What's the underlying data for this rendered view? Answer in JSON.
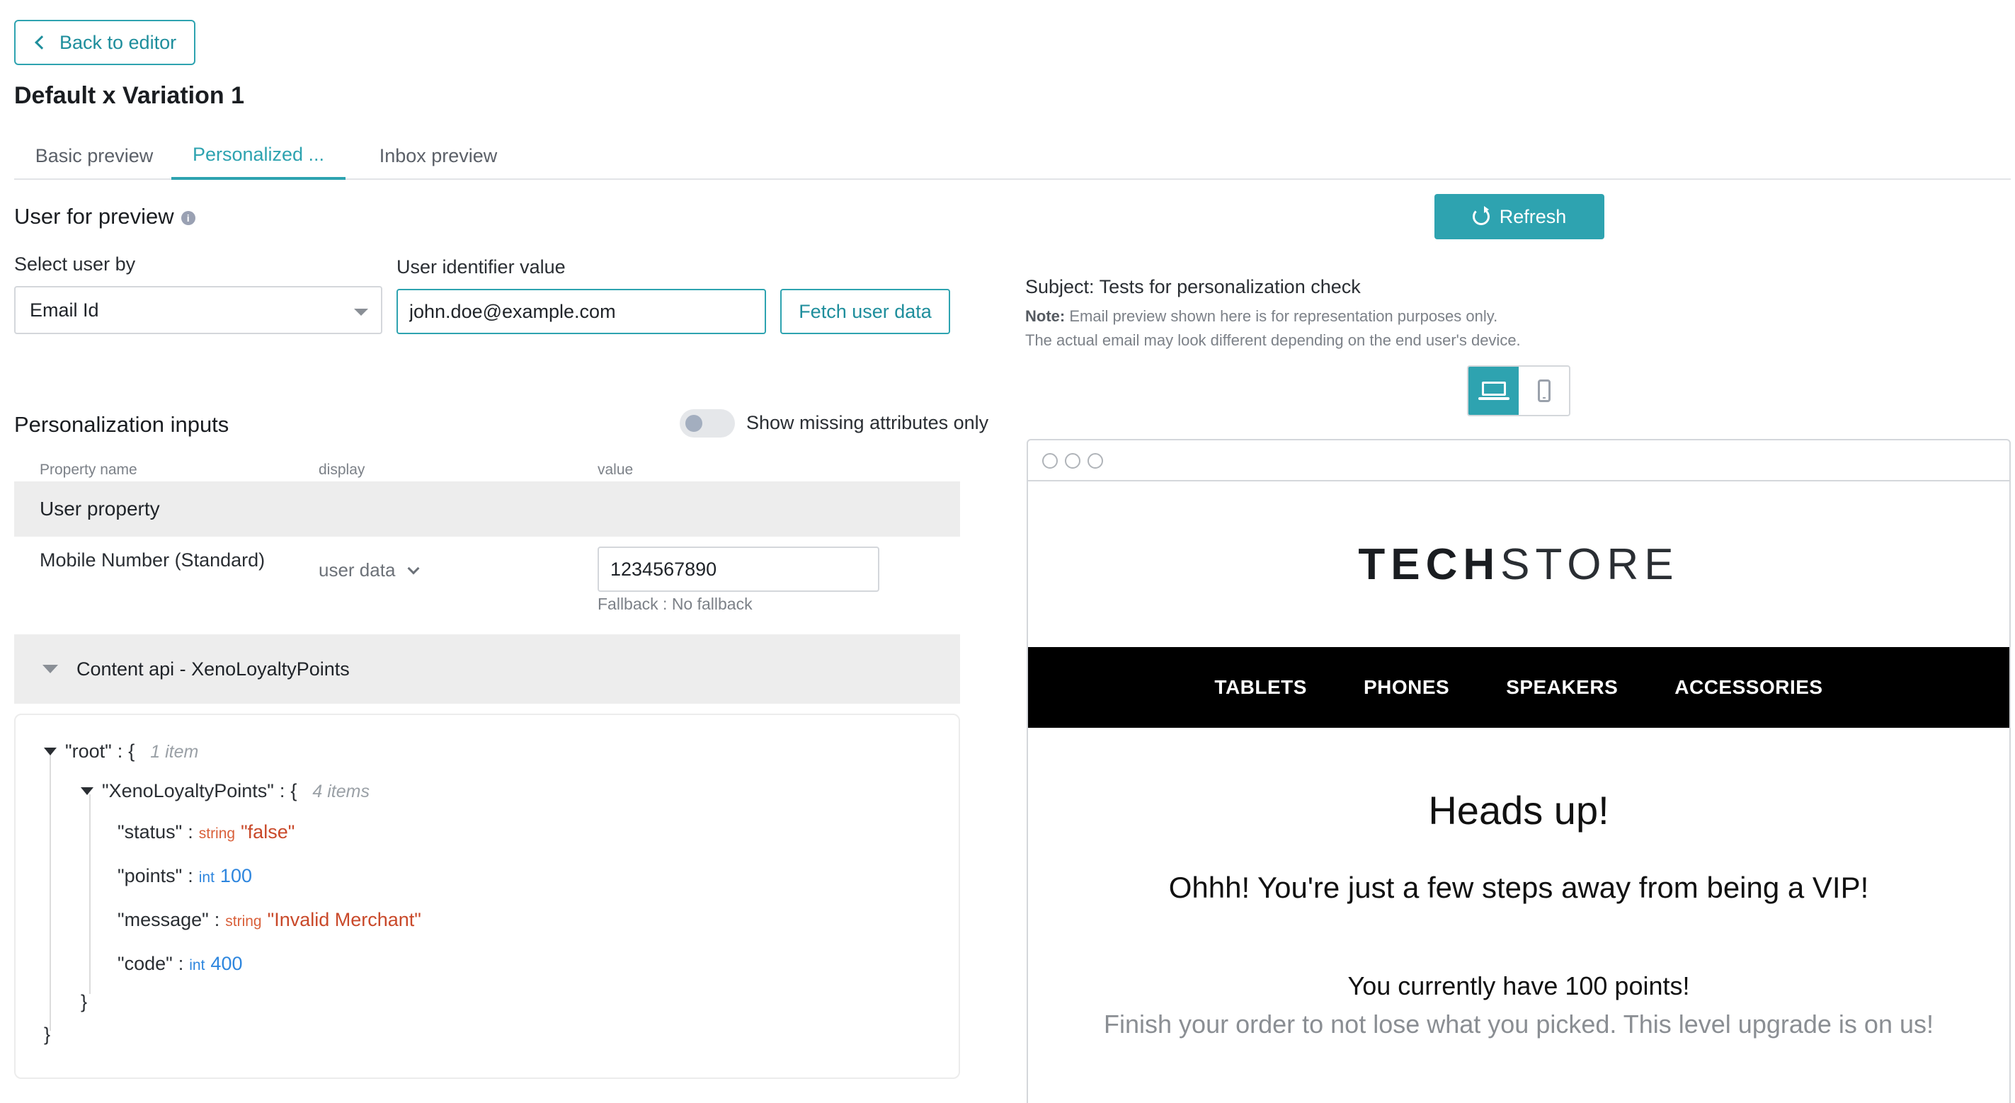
{
  "header": {
    "back_label": "Back to editor",
    "title": "Default x Variation 1"
  },
  "tabs": [
    {
      "label": "Basic preview"
    },
    {
      "label": "Personalized ..."
    },
    {
      "label": "Inbox preview"
    }
  ],
  "user_preview": {
    "title": "User for preview",
    "select_label": "Select user by",
    "select_value": "Email Id",
    "identifier_label": "User identifier value",
    "identifier_value": "john.doe@example.com",
    "fetch_label": "Fetch user data"
  },
  "personalization": {
    "title": "Personalization inputs",
    "toggle_label": "Show missing attributes only",
    "toggle_on": false,
    "columns": [
      "Property name",
      "display",
      "value"
    ],
    "group_label": "User property",
    "row": {
      "name": "Mobile Number (Standard)",
      "display": "user data",
      "value": "1234567890",
      "fallback": "Fallback : No fallback"
    },
    "api_label": "Content api - XenoLoyaltyPoints"
  },
  "json_view": {
    "root_key": "\"root\"",
    "root_count": "1 item",
    "child_key": "\"XenoLoyaltyPoints\"",
    "child_count": "4 items",
    "colon": ":",
    "brace_open": "{",
    "brace_close": "}",
    "fields": [
      {
        "key": "\"status\"",
        "type": "string",
        "value": "\"false\""
      },
      {
        "key": "\"points\"",
        "type": "int",
        "value": "100"
      },
      {
        "key": "\"message\"",
        "type": "string",
        "value": "\"Invalid Merchant\""
      },
      {
        "key": "\"code\"",
        "type": "int",
        "value": "400"
      }
    ]
  },
  "preview": {
    "refresh_label": "Refresh",
    "subject": "Subject: Tests for personalization check",
    "note_bold": "Note:",
    "note_line1": "Email preview shown here is for representation purposes only.",
    "note_line2": "The actual email may look different depending on the end user's device."
  },
  "email": {
    "logo_part1": "TECH",
    "logo_part2": "STORE",
    "nav": [
      "TABLETS",
      "PHONES",
      "SPEAKERS",
      "ACCESSORIES"
    ],
    "heading": "Heads up!",
    "subheading": "Ohhh! You're just a few steps away from being a VIP!",
    "points_line": "You currently have 100 points!",
    "finish_line": "Finish your order to not lose what you picked. This level upgrade is on us!"
  },
  "colors": {
    "accent": "#2ea3b0",
    "string_value": "#c9492a",
    "int_value": "#2e86de"
  }
}
